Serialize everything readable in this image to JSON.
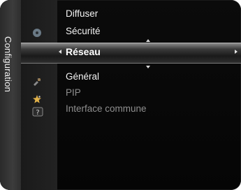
{
  "section": {
    "label": "Configuration"
  },
  "menu": {
    "items": [
      {
        "label": "Diffuser"
      },
      {
        "label": "Sécurité"
      },
      {
        "label": "Réseau"
      },
      {
        "label": "Général"
      },
      {
        "label": "PIP"
      },
      {
        "label": "Interface commune"
      }
    ]
  },
  "icons": [
    "disc-icon",
    "gear-icon",
    "satellite-icon",
    "star-icon",
    "help-icon"
  ]
}
